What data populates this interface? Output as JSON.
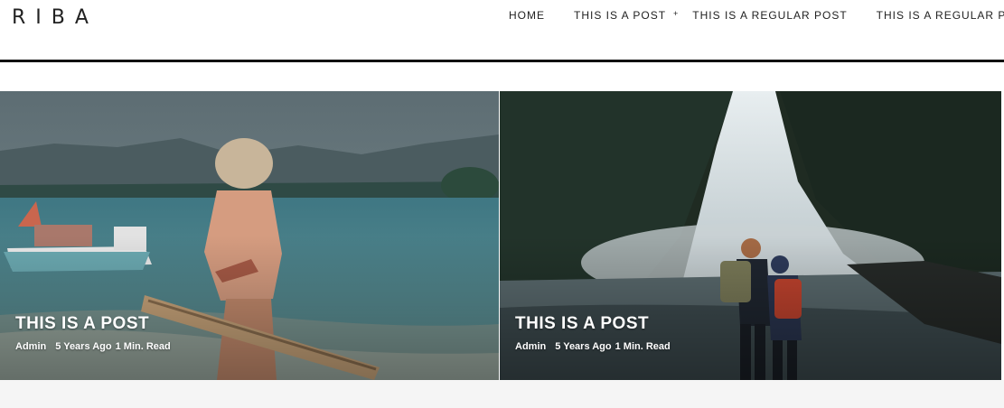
{
  "site": {
    "logo": "RIBA"
  },
  "nav": {
    "items": [
      {
        "label": "HOME"
      },
      {
        "label": "THIS IS A POST",
        "has_dropdown": true
      },
      {
        "label": "THIS IS A REGULAR POST"
      },
      {
        "label": "THIS IS A REGULAR POST"
      }
    ],
    "caret": "▾"
  },
  "posts": [
    {
      "title": "THIS IS A POST",
      "author": "Admin",
      "date": "5 Years Ago",
      "read_time": "1 Min. Read",
      "image": "beach-skateboard-photo"
    },
    {
      "title": "THIS IS A POST",
      "author": "Admin",
      "date": "5 Years Ago",
      "read_time": "1 Min. Read",
      "image": "waterfall-hikers-photo"
    }
  ],
  "colors": {
    "text": "#222222",
    "rule": "#111111",
    "footer_band": "#f5f5f5"
  }
}
